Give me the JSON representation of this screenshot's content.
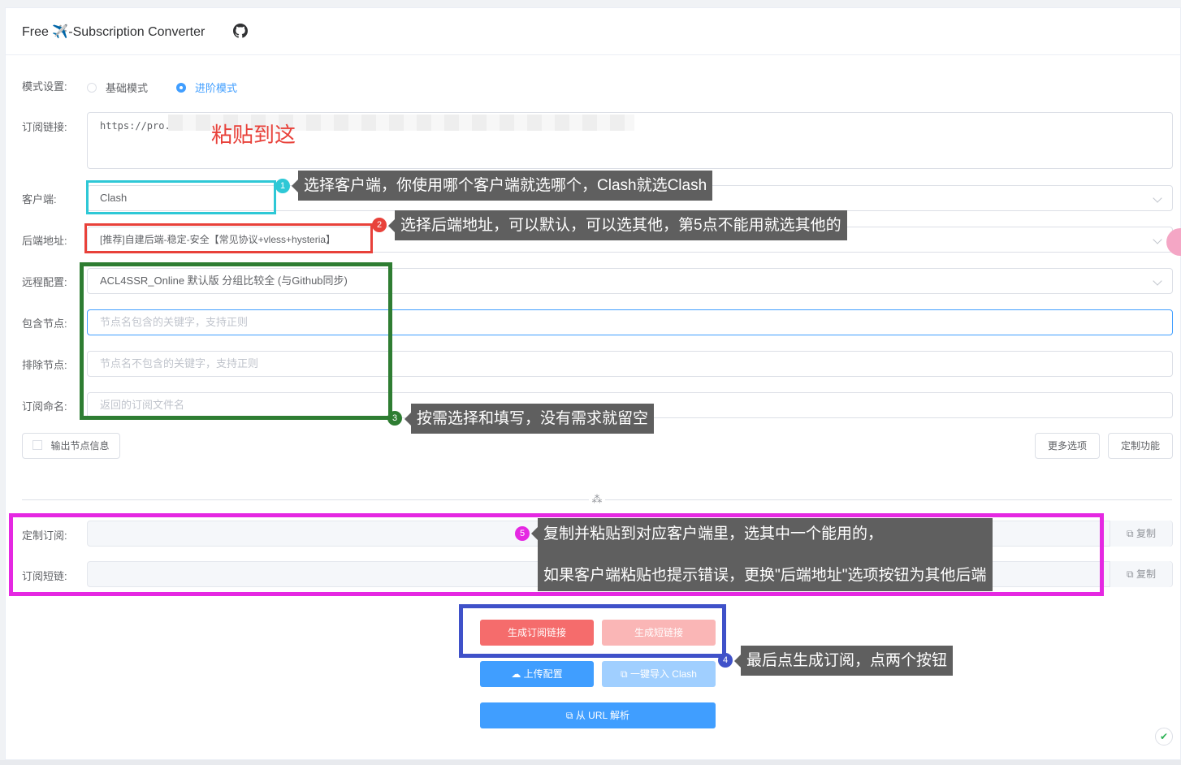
{
  "header": {
    "title": "Free ✈️-Subscription Converter",
    "github_icon": "github-icon"
  },
  "form": {
    "mode_label": "模式设置:",
    "mode_basic": "基础模式",
    "mode_advanced": "进阶模式",
    "mode_selected": "进阶模式",
    "sub_label": "订阅链接:",
    "sub_value": "https://pro..",
    "client_label": "客户端:",
    "client_value": "Clash",
    "backend_label": "后端地址:",
    "backend_value": "[推荐]自建后端-稳定-安全【常见协议+vless+hysteria】",
    "remote_label": "远程配置:",
    "remote_value": "ACL4SSR_Online 默认版 分组比较全 (与Github同步)",
    "include_label": "包含节点:",
    "include_placeholder": "节点名包含的关键字，支持正则",
    "exclude_label": "排除节点:",
    "exclude_placeholder": "节点名不包含的关键字，支持正则",
    "filename_label": "订阅命名:",
    "filename_placeholder": "返回的订阅文件名",
    "node_info_checkbox": "输出节点信息",
    "more_options": "更多选项",
    "custom_features": "定制功能"
  },
  "output": {
    "custom_sub_label": "定制订阅:",
    "short_link_label": "订阅短链:",
    "copy_label": "复制"
  },
  "buttons": {
    "generate_sub": "生成订阅链接",
    "generate_short": "生成短链接",
    "upload_config": "上传配置",
    "import_clash": "一键导入 Clash",
    "parse_url": "从 URL 解析"
  },
  "annotations": {
    "paste_here": "粘贴到这",
    "tip1": "选择客户端，你使用哪个客户端就选哪个，Clash就选Clash",
    "tip2": "选择后端地址，可以默认，可以选其他，第5点不能用就选其他的",
    "tip3": "按需选择和填写，没有需求就留空",
    "tip4": "最后点生成订阅，点两个按钮",
    "tip5_line1": "复制并粘贴到对应客户端里，选其中一个能用的，",
    "tip5_line2": "如果客户端粘贴也提示错误，更换\"后端地址\"选项按钮为其他后端",
    "n1": "1",
    "n2": "2",
    "n3": "3",
    "n4": "4",
    "n5": "5"
  },
  "colors": {
    "cyan": "#2ec8d6",
    "red": "#e8413a",
    "green": "#2e7d32",
    "blue": "#3f51c9",
    "magenta": "#e528e2",
    "primary": "#409eff",
    "danger": "#f56c6c"
  }
}
